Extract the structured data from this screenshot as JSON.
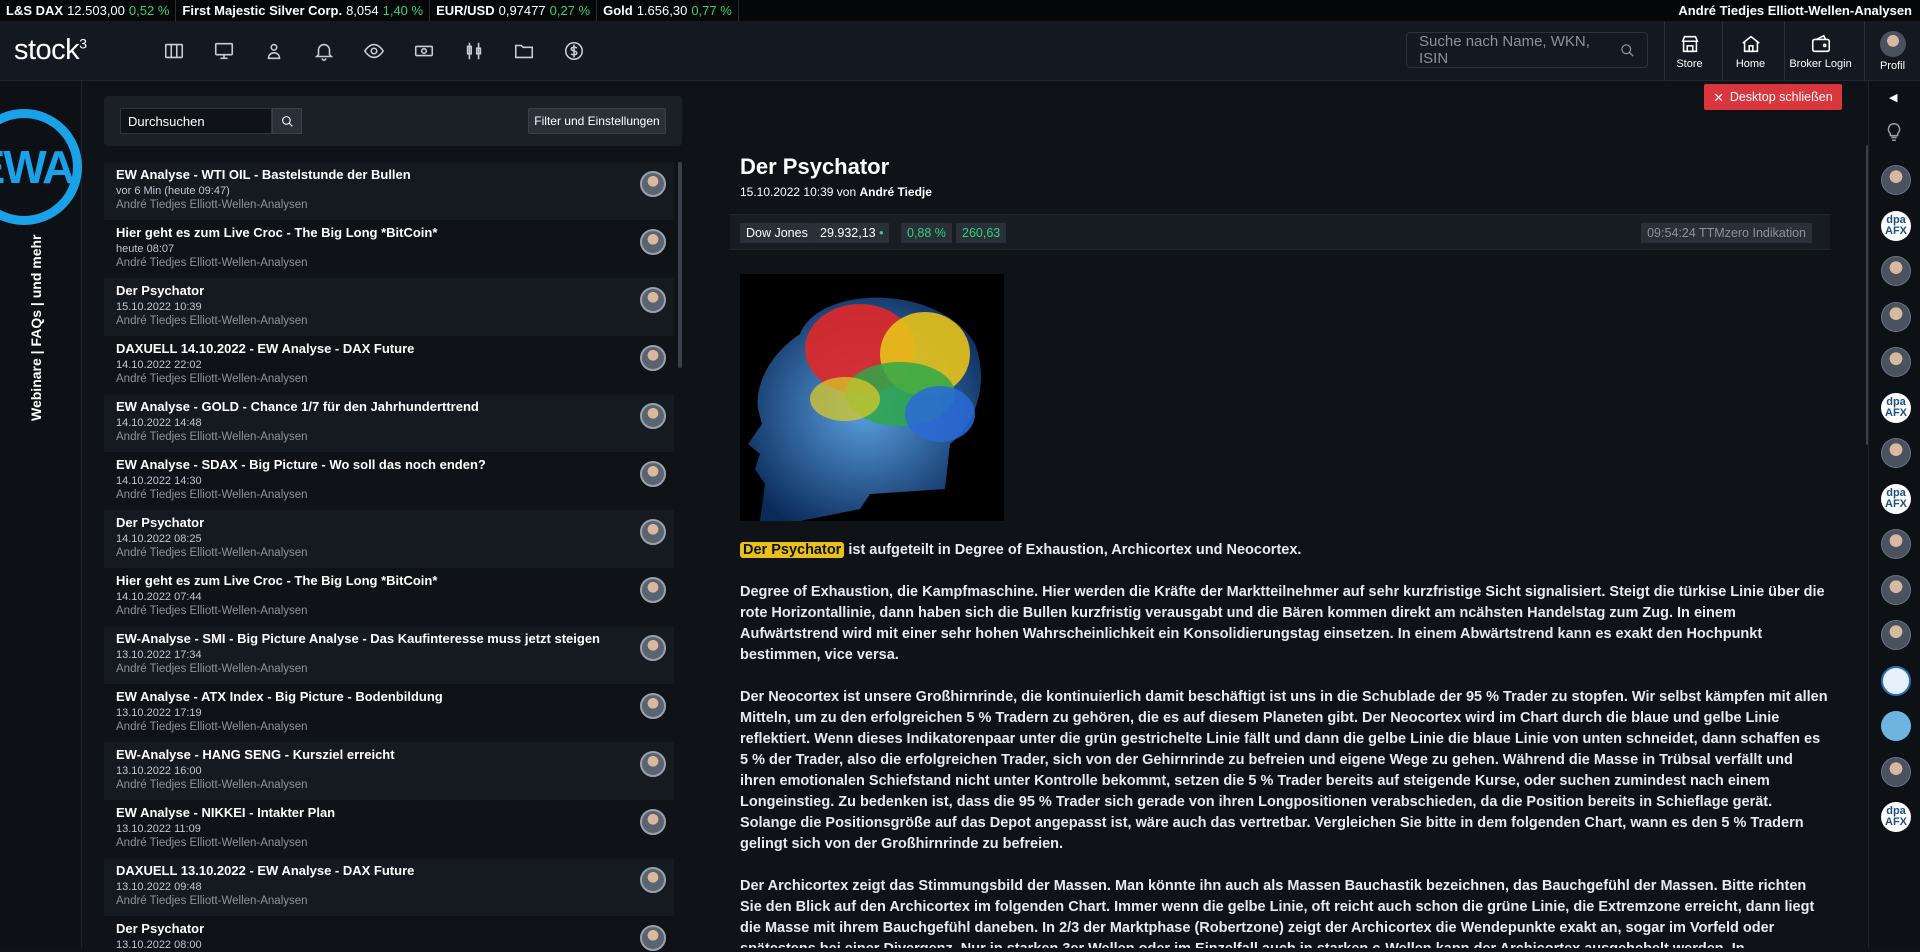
{
  "ticker": [
    {
      "name": "L&S DAX",
      "value": "12.503,00",
      "change": "0,52 %"
    },
    {
      "name": "First Majestic Silver Corp.",
      "value": "8,054",
      "change": "1,40 %"
    },
    {
      "name": "EUR/USD",
      "value": "0,97477",
      "change": "0,27 %"
    },
    {
      "name": "Gold",
      "value": "1.656,30",
      "change": "0,77 %"
    }
  ],
  "ticker_author": "André Tiedjes Elliott-Wellen-Analysen",
  "nav": {
    "logo": "stock",
    "logo_sup": "3",
    "search_placeholder": "Suche nach Name, WKN, ISIN",
    "store": "Store",
    "home": "Home",
    "broker": "Broker Login",
    "profile": "Profil"
  },
  "leftrail": {
    "logo": "EWA",
    "text": "Webinare | FAQs | und mehr"
  },
  "panel": {
    "search_value": "Durchsuchen",
    "filter_button": "Filter und Einstellungen",
    "items": [
      {
        "title": "EW Analyse - WTI OIL - Bastelstunde der Bullen",
        "date": "vor 6 Min (heute 09:47)",
        "author": "André Tiedjes Elliott-Wellen-Analysen"
      },
      {
        "title": "Hier geht es zum Live Croc - The Big Long *BitCoin*",
        "date": "heute 08:07",
        "author": "André Tiedjes Elliott-Wellen-Analysen"
      },
      {
        "title": "Der Psychator",
        "date": "15.10.2022 10:39",
        "author": "André Tiedjes Elliott-Wellen-Analysen"
      },
      {
        "title": "DAXUELL 14.10.2022 - EW Analyse - DAX Future",
        "date": "14.10.2022 22:02",
        "author": "André Tiedjes Elliott-Wellen-Analysen"
      },
      {
        "title": "EW Analyse - GOLD - Chance 1/7 für den Jahrhunderttrend",
        "date": "14.10.2022 14:48",
        "author": "André Tiedjes Elliott-Wellen-Analysen"
      },
      {
        "title": "EW Analyse - SDAX - Big Picture - Wo soll das noch enden?",
        "date": "14.10.2022 14:30",
        "author": "André Tiedjes Elliott-Wellen-Analysen"
      },
      {
        "title": "Der Psychator",
        "date": "14.10.2022 08:25",
        "author": "André Tiedjes Elliott-Wellen-Analysen"
      },
      {
        "title": "Hier geht es zum Live Croc - The Big Long *BitCoin*",
        "date": "14.10.2022 07:44",
        "author": "André Tiedjes Elliott-Wellen-Analysen"
      },
      {
        "title": "EW-Analyse - SMI - Big Picture Analyse - Das Kaufinteresse muss jetzt steigen",
        "date": "13.10.2022 17:34",
        "author": "André Tiedjes Elliott-Wellen-Analysen"
      },
      {
        "title": "EW Analyse - ATX Index - Big Picture - Bodenbildung",
        "date": "13.10.2022 17:19",
        "author": "André Tiedjes Elliott-Wellen-Analysen"
      },
      {
        "title": "EW-Analyse - HANG SENG - Kursziel erreicht",
        "date": "13.10.2022 16:00",
        "author": "André Tiedjes Elliott-Wellen-Analysen"
      },
      {
        "title": "EW Analyse - NIKKEI - Intakter Plan",
        "date": "13.10.2022 11:09",
        "author": "André Tiedjes Elliott-Wellen-Analysen"
      },
      {
        "title": "DAXUELL 13.10.2022 - EW Analyse - DAX Future",
        "date": "13.10.2022 09:48",
        "author": "André Tiedjes Elliott-Wellen-Analysen"
      },
      {
        "title": "Der Psychator",
        "date": "13.10.2022 08:00",
        "author": ""
      }
    ]
  },
  "article": {
    "close_button": "Desktop schließen",
    "title": "Der Psychator",
    "date": "15.10.2022 10:39",
    "by": "von",
    "author": "André Tiedje",
    "quote": {
      "name": "Dow Jones",
      "value": "29.932,13",
      "pct": "0,88 %",
      "abs": "260,63",
      "time": "09:54:24 TTMzero Indikation"
    },
    "highlight": "Der Psychator",
    "p1_rest": " ist aufgeteilt in Degree of Exhaustion, Archicortex und Neocortex.",
    "p2": "Degree of Exhaustion, die Kampfmaschine. Hier werden die Kräfte der Marktteilnehmer auf sehr kurzfristige Sicht signalisiert. Steigt die türkise Linie über die rote Horizontallinie, dann haben sich die Bullen kurzfristig verausgabt und die Bären kommen direkt am ncähsten Handelstag zum Zug. In einem Aufwärtstrend wird mit einer sehr hohen Wahrscheinlichkeit ein Konsolidierungstag einsetzen. In einem Abwärtstrend kann es exakt den Hochpunkt bestimmen, vice versa.",
    "p3": "Der Neocortex ist unsere Großhirnrinde, die kontinuierlich damit beschäftigt ist uns in die Schublade der 95 % Trader zu stopfen. Wir selbst kämpfen mit allen Mitteln, um zu den erfolgreichen 5 % Tradern zu gehören, die es auf diesem Planeten gibt. Der Neocortex wird im Chart durch die blaue und gelbe Linie reflektiert. Wenn dieses Indikatorenpaar unter die grün gestrichelte Linie fällt und dann die gelbe Linie die blaue Linie von unten schneidet, dann schaffen es 5 % der Trader, also die erfolgreichen Trader, sich von der Gehirnrinde zu befreien und eigene Wege zu gehen. Während die Masse in Trübsal verfällt und ihren emotionalen Schiefstand nicht unter Kontrolle bekommt, setzen die 5 % Trader bereits auf steigende Kurse, oder suchen zumindest nach einem Longeinstieg. Zu bedenken ist, dass die 95 % Trader sich gerade von ihren Longpositionen verabschieden, da die Position bereits in Schieflage gerät. Solange die Positionsgröße auf das Depot angepasst ist, wäre auch das vertretbar. Vergleichen Sie bitte in dem folgenden Chart, wann es den 5 % Tradern gelingt sich von der Großhirnrinde zu befreien.",
    "p4": "Der Archicortex zeigt das Stimmungsbild der Massen. Man könnte ihn auch als Massen Bauchastik bezeichnen, das Bauchgefühl der Massen. Bitte richten Sie den Blick auf den Archicortex im folgenden Chart. Immer wenn die gelbe Linie, oft reicht auch schon die grüne Linie, die Extremzone erreicht, dann liegt die Masse mit ihrem Bauchgefühl daneben. In 2/3 der Marktphase (Robertzone) zeigt der Archicortex die Wendepunkte exakt an, sogar im Vorfeld oder spätestens bei einer Divergenz. Nur in starken 3er Wellen oder im Einzelfall auch in starken c-Wellen kann der Archicortex ausgehebelt werden. In"
  },
  "rightrail": {
    "avatars": [
      "person",
      "dpa",
      "person",
      "person",
      "person",
      "dpa",
      "person",
      "dpa",
      "person",
      "person",
      "person",
      "bank",
      "blue",
      "person",
      "dpa"
    ],
    "dpa_label_top": "dpa",
    "dpa_label_bottom": "AFX"
  }
}
